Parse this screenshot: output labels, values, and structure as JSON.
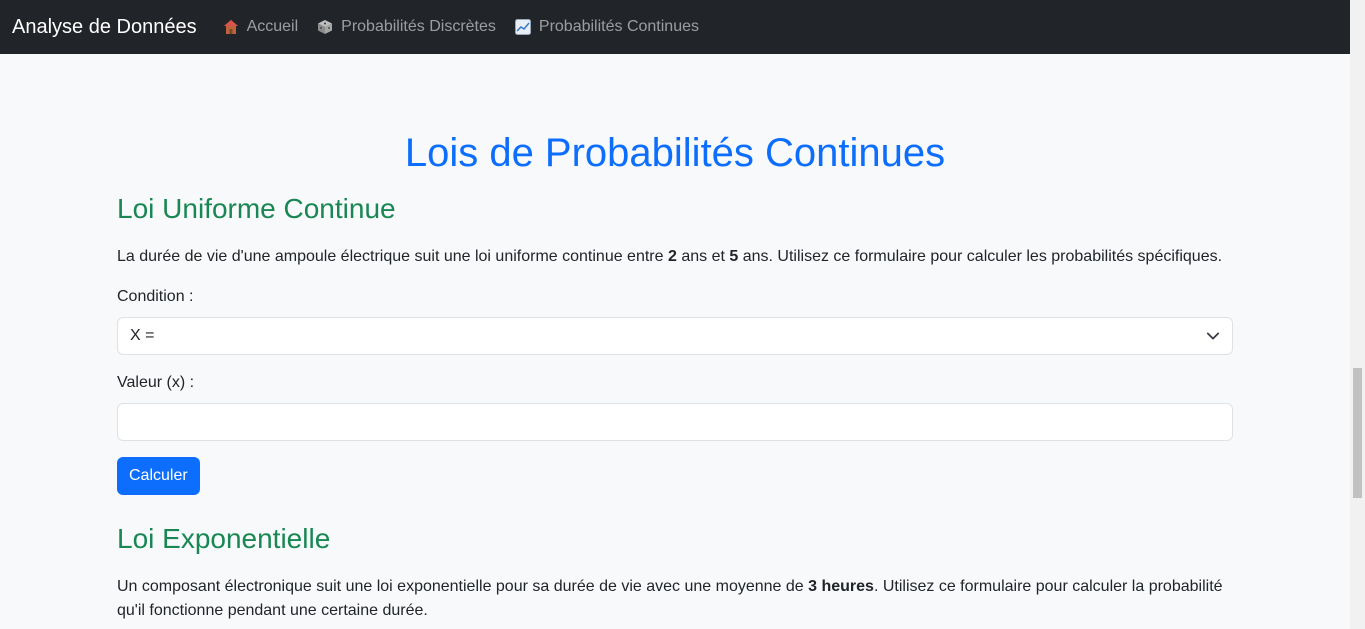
{
  "navbar": {
    "brand": "Analyse de Données",
    "links": [
      {
        "label": "Accueil",
        "icon": "house-icon"
      },
      {
        "label": "Probabilités Discrètes",
        "icon": "cube-icon"
      },
      {
        "label": "Probabilités Continues",
        "icon": "chart-icon"
      }
    ]
  },
  "page": {
    "title": "Lois de Probabilités Continues"
  },
  "uniform": {
    "title": "Loi Uniforme Continue",
    "desc_before": "La durée de vie d'une ampoule électrique suit une loi uniforme continue entre ",
    "a": "2",
    "desc_mid": " ans et ",
    "b": "5",
    "desc_after": " ans. Utilisez ce formulaire pour calculer les probabilités spécifiques.",
    "condition_label": "Condition :",
    "condition_value": "X =",
    "value_label": "Valeur (x) :",
    "value_input": "",
    "button_label": "Calculer"
  },
  "exponential": {
    "title": "Loi Exponentielle",
    "desc_before": "Un composant électronique suit une loi exponentielle pour sa durée de vie avec une moyenne de ",
    "mean": "3 heures",
    "desc_after": ". Utilisez ce formulaire pour calculer la probabilité qu'il fonctionne pendant une certaine durée."
  },
  "colors": {
    "navbar_bg": "#212529",
    "title": "#0d6efd",
    "section_title": "#198754",
    "button": "#0d6efd"
  }
}
